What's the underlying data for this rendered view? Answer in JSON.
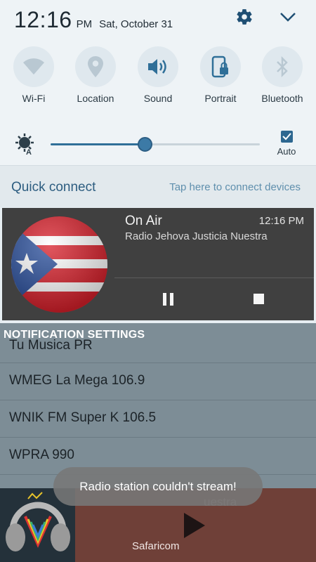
{
  "status": {
    "time": "12:16",
    "ampm": "PM",
    "date": "Sat, October 31"
  },
  "icons": {
    "settings": "gear-icon",
    "expand": "chevron-down-icon"
  },
  "toggles": [
    {
      "label": "Wi-Fi",
      "icon": "wifi-icon"
    },
    {
      "label": "Location",
      "icon": "location-icon"
    },
    {
      "label": "Sound",
      "icon": "sound-icon"
    },
    {
      "label": "Portrait",
      "icon": "portrait-lock-icon"
    },
    {
      "label": "Bluetooth",
      "icon": "bluetooth-icon"
    }
  ],
  "brightness": {
    "level": 0.45,
    "auto_label": "Auto",
    "auto_checked": true
  },
  "quick_connect": {
    "title": "Quick connect",
    "hint": "Tap here to connect devices"
  },
  "media": {
    "title": "On Air",
    "time": "12:16 PM",
    "station": "Radio Jehova Justicia Nuestra"
  },
  "background_app": {
    "section_label": "NOTIFICATION SETTINGS",
    "stations": [
      "Tu Musica PR",
      "WMEG La Mega 106.9",
      "WNIK FM Super K 106.5",
      "WPRA 990"
    ],
    "player_subtitle": "uestra",
    "player_label": "Safaricom"
  },
  "toast": {
    "message": "Radio station couldn't stream!"
  },
  "colors": {
    "accent": "#2f6f98",
    "panel": "#eef3f6",
    "media_bg": "#404040"
  }
}
